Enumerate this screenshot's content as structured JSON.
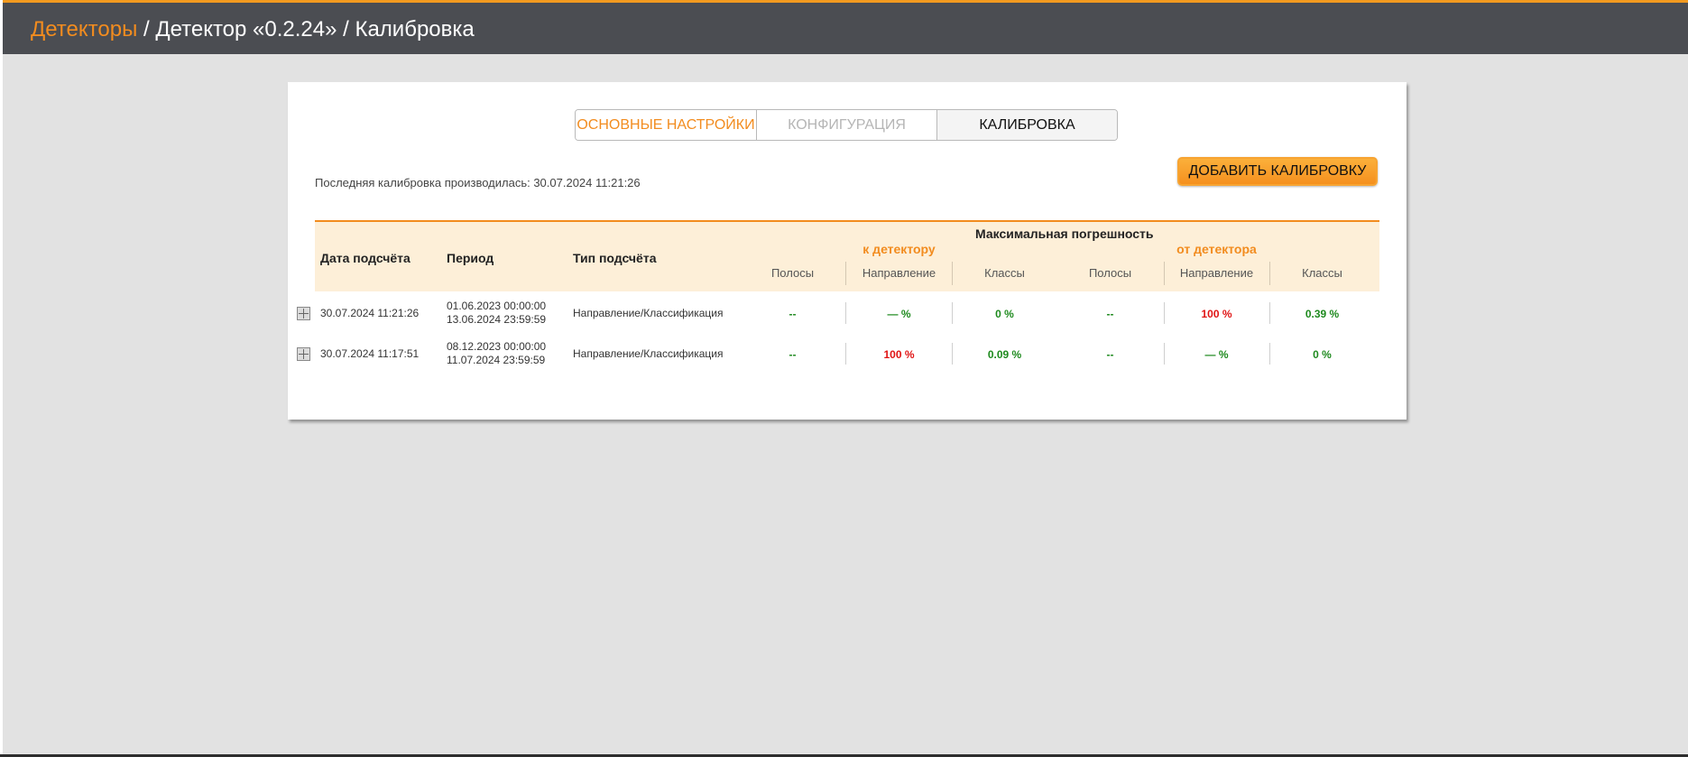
{
  "breadcrumb": {
    "link": "Детекторы",
    "rest": " / Детектор «0.2.24» / Калибровка"
  },
  "tabs": [
    {
      "label": "ОСНОВНЫЕ НАСТРОЙКИ"
    },
    {
      "label": "КОНФИГУРАЦИЯ"
    },
    {
      "label": "КАЛИБРОВКА"
    }
  ],
  "last_calibration": "Последняя калибровка производилась: 30.07.2024 11:21:26",
  "add_button": "ДОБАВИТЬ КАЛИБРОВКУ",
  "table": {
    "headers": {
      "date": "Дата подсчёта",
      "period": "Период",
      "type": "Тип подсчёта",
      "max_error": "Максимальная погрешность",
      "to_detector": "к детектору",
      "from_detector": "от детектора",
      "lanes": "Полосы",
      "direction": "Направление",
      "classes": "Классы"
    },
    "rows": [
      {
        "date": "30.07.2024 11:21:26",
        "period_start": "01.06.2023 00:00:00",
        "period_end": "13.06.2024 23:59:59",
        "type": "Направление/Классификация",
        "values": [
          "--",
          "— %",
          "0 %",
          "--",
          "100 %",
          "0.39 %"
        ]
      },
      {
        "date": "30.07.2024 11:17:51",
        "period_start": "08.12.2023 00:00:00",
        "period_end": "11.07.2024 23:59:59",
        "type": "Направление/Классификация",
        "values": [
          "--",
          "100 %",
          "0.09 %",
          "--",
          "— %",
          "0 %"
        ]
      }
    ]
  },
  "colors": {
    "accent": "#f28c1f",
    "topbar": "#4b4d52",
    "ok": "#1e8a1e",
    "error": "#e01414"
  }
}
